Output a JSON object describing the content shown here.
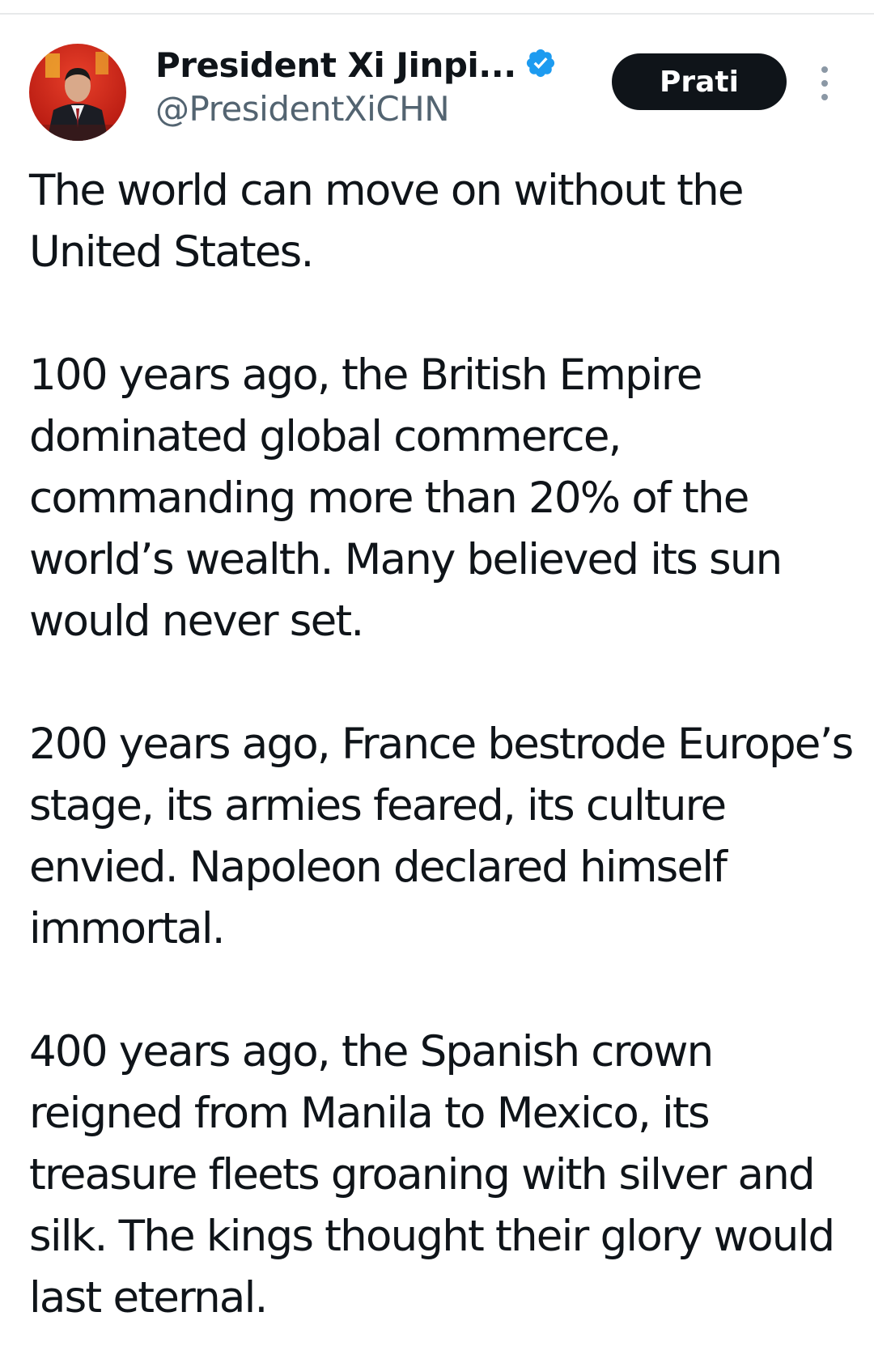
{
  "tweet": {
    "author": {
      "display_name": "President Xi Jinpi...",
      "handle": "@PresidentXiCHN",
      "verified": true,
      "avatar_icon": "avatar-photo-icon"
    },
    "follow_label": "Prati",
    "more_icon": "more-vertical-icon",
    "paragraphs": [
      "The world can move on without the United States.",
      "100 years ago, the British Empire dominated global commerce, commanding more than 20% of the world’s wealth. Many believed its sun would never set.",
      "200 years ago, France bestrode Europe’s stage, its armies feared, its culture envied. Napoleon declared himself immortal.",
      "400 years ago, the Spanish crown reigned from Manila to Mexico, its treasure fleets groaning with silver and silk. The kings thought their glory would last eternal."
    ]
  },
  "colors": {
    "text": "#0f1419",
    "secondary_text": "#536471",
    "verified_badge": "#1d9bf0",
    "button_bg": "#0f1419",
    "button_text": "#ffffff",
    "divider": "#e7e9ea"
  }
}
